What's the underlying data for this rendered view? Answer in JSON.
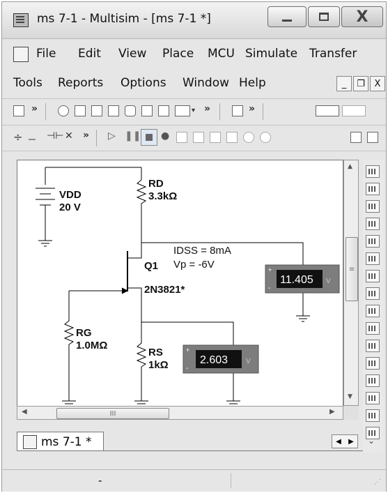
{
  "window": {
    "title": "ms 7-1 - Multisim - [ms 7-1 *]"
  },
  "menu": {
    "row1": [
      "File",
      "Edit",
      "View",
      "Place",
      "MCU",
      "Simulate",
      "Transfer"
    ],
    "row2": [
      "Tools",
      "Reports",
      "Options",
      "Window",
      "Help"
    ]
  },
  "mdi": {
    "minimize": "_",
    "restore": "❐",
    "close": "X"
  },
  "circuit": {
    "vdd": {
      "name": "VDD",
      "value": "20 V"
    },
    "rd": {
      "name": "RD",
      "value": "3.3kΩ"
    },
    "q1": {
      "name": "Q1",
      "model": "2N3821*",
      "idss": "IDSS = 8mA",
      "vp": "Vp = -6V"
    },
    "rg": {
      "name": "RG",
      "value": "1.0MΩ"
    },
    "rs": {
      "name": "RS",
      "value": "1kΩ"
    },
    "meter_drain": {
      "reading": "11.405",
      "plus": "+",
      "minus": "-",
      "v": "V"
    },
    "meter_source": {
      "reading": "2.603",
      "plus": "+",
      "minus": "-",
      "v": "V"
    }
  },
  "scroll": {
    "h_thumb_label": "III",
    "v_thumb_label": "≡"
  },
  "tabs": [
    {
      "label": "ms 7-1 *"
    }
  ],
  "status": {
    "text": "-"
  },
  "icons": [
    "app-icon",
    "new-icon",
    "zoom-icon",
    "component-icon",
    "grapher-icon",
    "play-icon",
    "pause-icon",
    "stop-icon"
  ]
}
